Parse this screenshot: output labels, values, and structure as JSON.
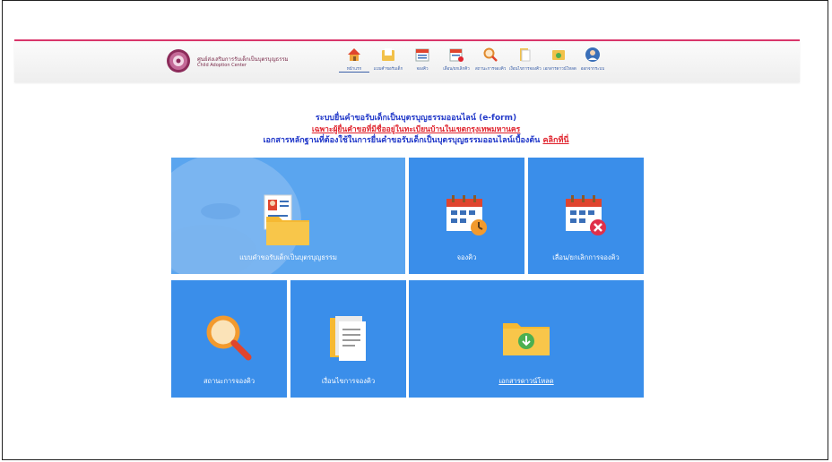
{
  "header": {
    "logo_name_th": "ศูนย์ส่งเสริมการรับเด็กเป็นบุตรบุญธรรม",
    "logo_name_en": "Child Adoption Center",
    "nav": [
      {
        "label": "หน้าแรก",
        "icon": "home-icon"
      },
      {
        "label": "แบบคำขอรับเด็ก",
        "icon": "folder-icon"
      },
      {
        "label": "จองคิว",
        "icon": "calendar-icon"
      },
      {
        "label": "เลื่อน/ยกเลิกคิว",
        "icon": "calendar-edit-icon"
      },
      {
        "label": "สถานะการจองคิว",
        "icon": "search-icon"
      },
      {
        "label": "เงื่อนไขการจองคิว",
        "icon": "document-icon"
      },
      {
        "label": "เอกสารดาวน์โหลด",
        "icon": "download-icon"
      },
      {
        "label": "ออกจากระบบ",
        "icon": "user-icon"
      }
    ]
  },
  "intro": {
    "line1": "ระบบยื่นคำขอรับเด็กเป็นบุตรบุญธรรมออนไลน์ (e-form)",
    "line2": "เฉพาะผู้ยื่นคำขอที่มีชื่ออยู่ในทะเบียนบ้านในเขตกรุงเทพมหานคร",
    "line3": "เอกสารหลักฐานที่ต้องใช้ในการยื่นคำขอรับเด็กเป็นบุตรบุญธรรมออนไลน์เบื้องต้น",
    "line3_link": "คลิกที่นี่"
  },
  "tiles": {
    "application_form": "แบบคำขอรับเด็กเป็นบุตรบุญธรรม",
    "book_queue": "จองคิว",
    "reschedule_queue": "เลื่อน/ยกเลิกการจองคิว",
    "queue_status": "สถานะการจองคิว",
    "queue_conditions": "เงื่อนไขการจองคิว",
    "download_documents": "เอกสารดาวน์โหลด"
  },
  "colors": {
    "accent_pink": "#d9366b",
    "tile_blue": "#3a8eea",
    "title_blue": "#2239c9",
    "alert_red": "#e0242e"
  }
}
